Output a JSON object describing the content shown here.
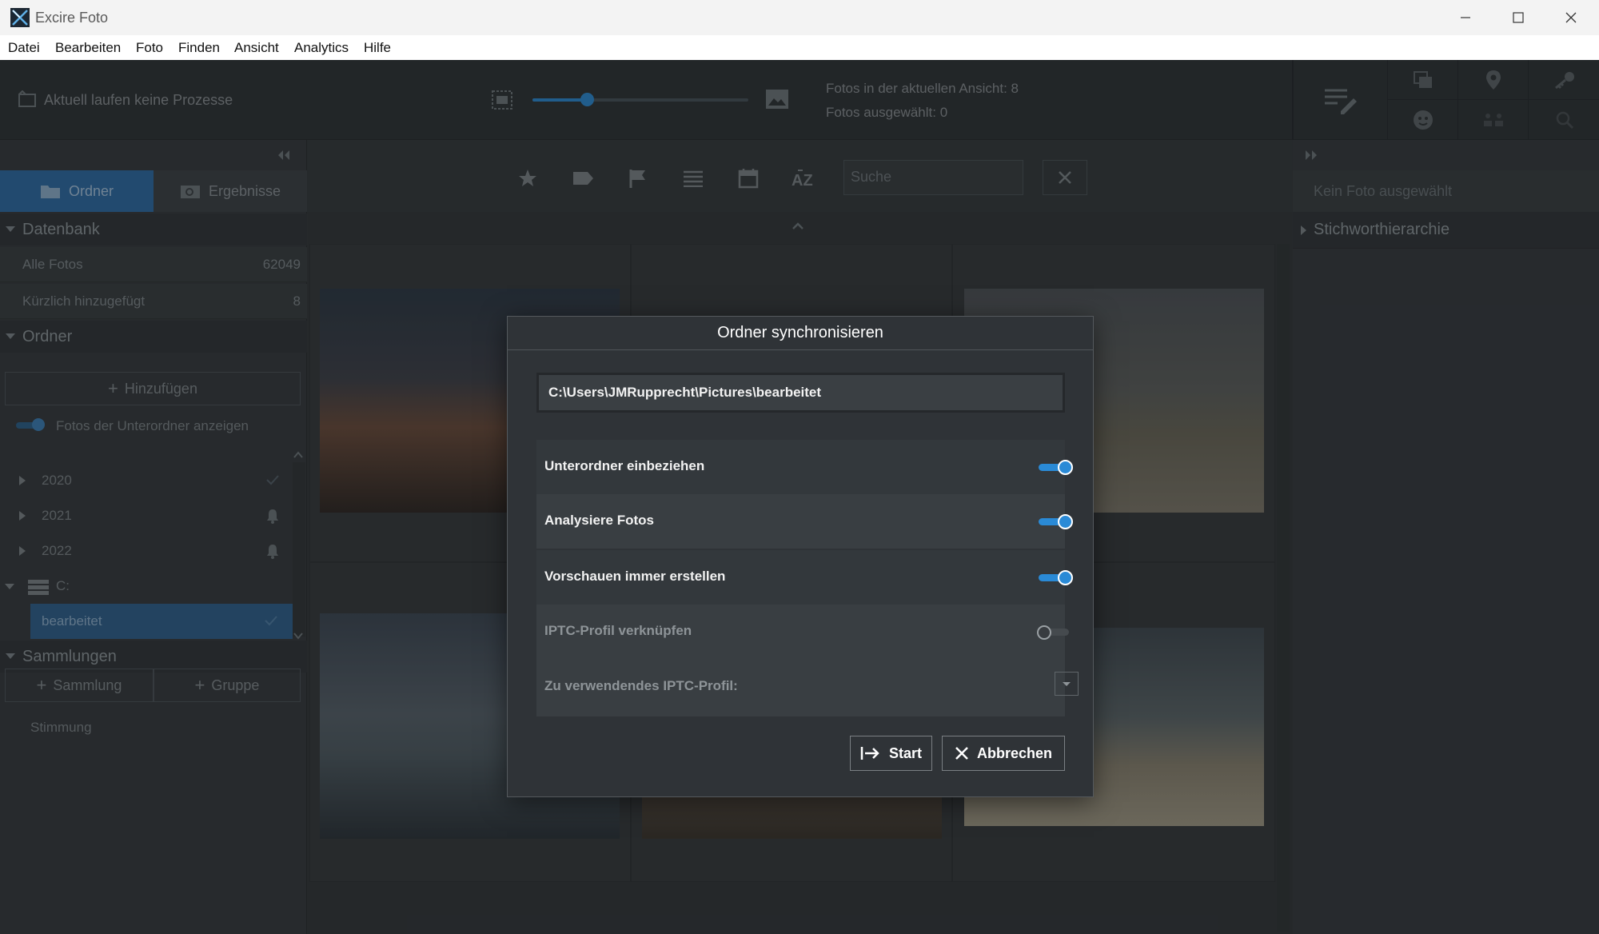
{
  "window": {
    "title": "Excire Foto",
    "controls": {
      "minimize": "minimize-icon",
      "maximize": "maximize-icon",
      "close": "close-icon"
    }
  },
  "menu": [
    "Datei",
    "Bearbeiten",
    "Foto",
    "Finden",
    "Ansicht",
    "Analytics",
    "Hilfe"
  ],
  "topbar": {
    "process_status": "Aktuell laufen keine Prozesse",
    "photos_in_view": "Fotos in der aktuellen Ansicht: 8",
    "photos_selected": "Fotos ausgewählt: 0",
    "thumbnail_size": 0.2
  },
  "sidebar": {
    "tabs": {
      "folders": "Ordner",
      "results": "Ergebnisse"
    },
    "database": {
      "header": "Datenbank",
      "rows": [
        {
          "label": "Alle Fotos",
          "count": "62049"
        },
        {
          "label": "Kürzlich hinzugefügt",
          "count": "8"
        }
      ]
    },
    "folders": {
      "header": "Ordner",
      "add_button": "Hinzufügen",
      "subfolder_toggle": "Fotos der Unterordner anzeigen",
      "tree": [
        {
          "label": "2020",
          "status": "check-icon"
        },
        {
          "label": "2021",
          "status": "bell-icon"
        },
        {
          "label": "2022",
          "status": "bell-icon"
        },
        {
          "label": "C:",
          "status": ""
        },
        {
          "label": "bearbeitet",
          "status": "check-icon"
        }
      ]
    },
    "collections": {
      "header": "Sammlungen",
      "add_collection": "Sammlung",
      "add_group": "Gruppe",
      "items": [
        "Stimmung"
      ]
    }
  },
  "filterbar": {
    "search_placeholder": "Suche",
    "icons": [
      "star-icon",
      "tag-icon",
      "flag-icon",
      "list-icon",
      "calendar-icon",
      "sort-az-icon"
    ]
  },
  "right_panel": {
    "info": "Kein Foto ausgewählt",
    "section": "Stichworthierarchie"
  },
  "dialog": {
    "title": "Ordner synchronisieren",
    "path": "C:\\Users\\JMRupprecht\\Pictures\\bearbeitet",
    "options": [
      {
        "label": "Unterordner einbeziehen",
        "enabled": true,
        "disabled": false
      },
      {
        "label": "Analysiere Fotos",
        "enabled": true,
        "disabled": false
      },
      {
        "label": "Vorschauen immer erstellen",
        "enabled": true,
        "disabled": false
      },
      {
        "label": "IPTC-Profil verknüpfen",
        "enabled": false,
        "disabled": true
      }
    ],
    "iptc_profile_label": "Zu verwendendes IPTC-Profil:",
    "start_button": "Start",
    "cancel_button": "Abbrechen"
  },
  "colors": {
    "accent": "#2a8ad6",
    "app_background": "#323639",
    "dialog_background": "#2f3337",
    "selection": "#2e5f8e"
  }
}
